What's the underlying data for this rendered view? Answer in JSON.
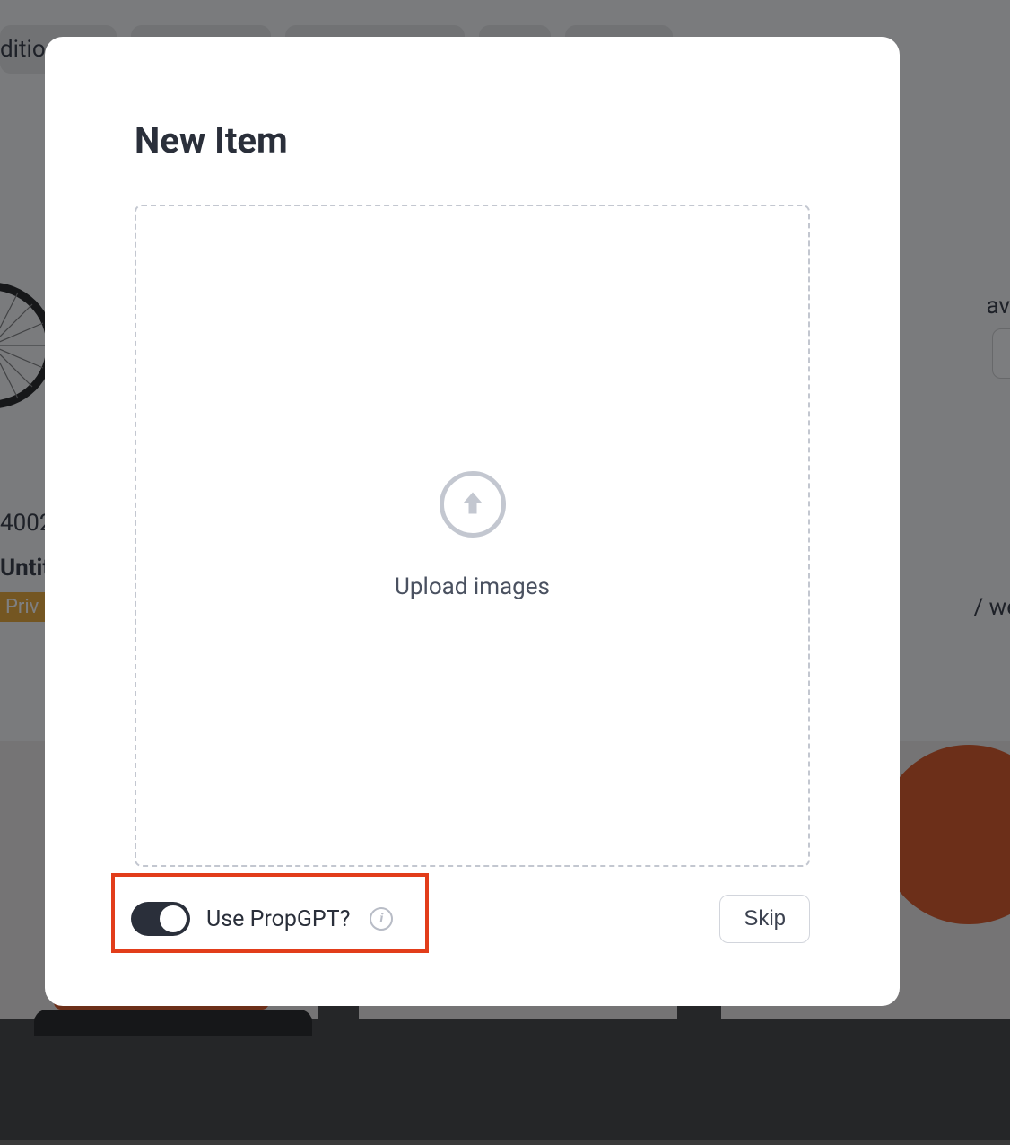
{
  "modal": {
    "title": "New Item",
    "upload_label": "Upload images",
    "toggle_label": "Use PropGPT?",
    "skip_label": "Skip"
  },
  "background": {
    "crop_left_top": "ditio",
    "id_fragment": "4002",
    "title_fragment": "Untit",
    "priv_badge": "Priv",
    "avatar_fragment": "av",
    "we_fragment": "/ we"
  },
  "icons": {
    "upload": "upload-arrow-circle-icon",
    "info": "info-icon"
  }
}
